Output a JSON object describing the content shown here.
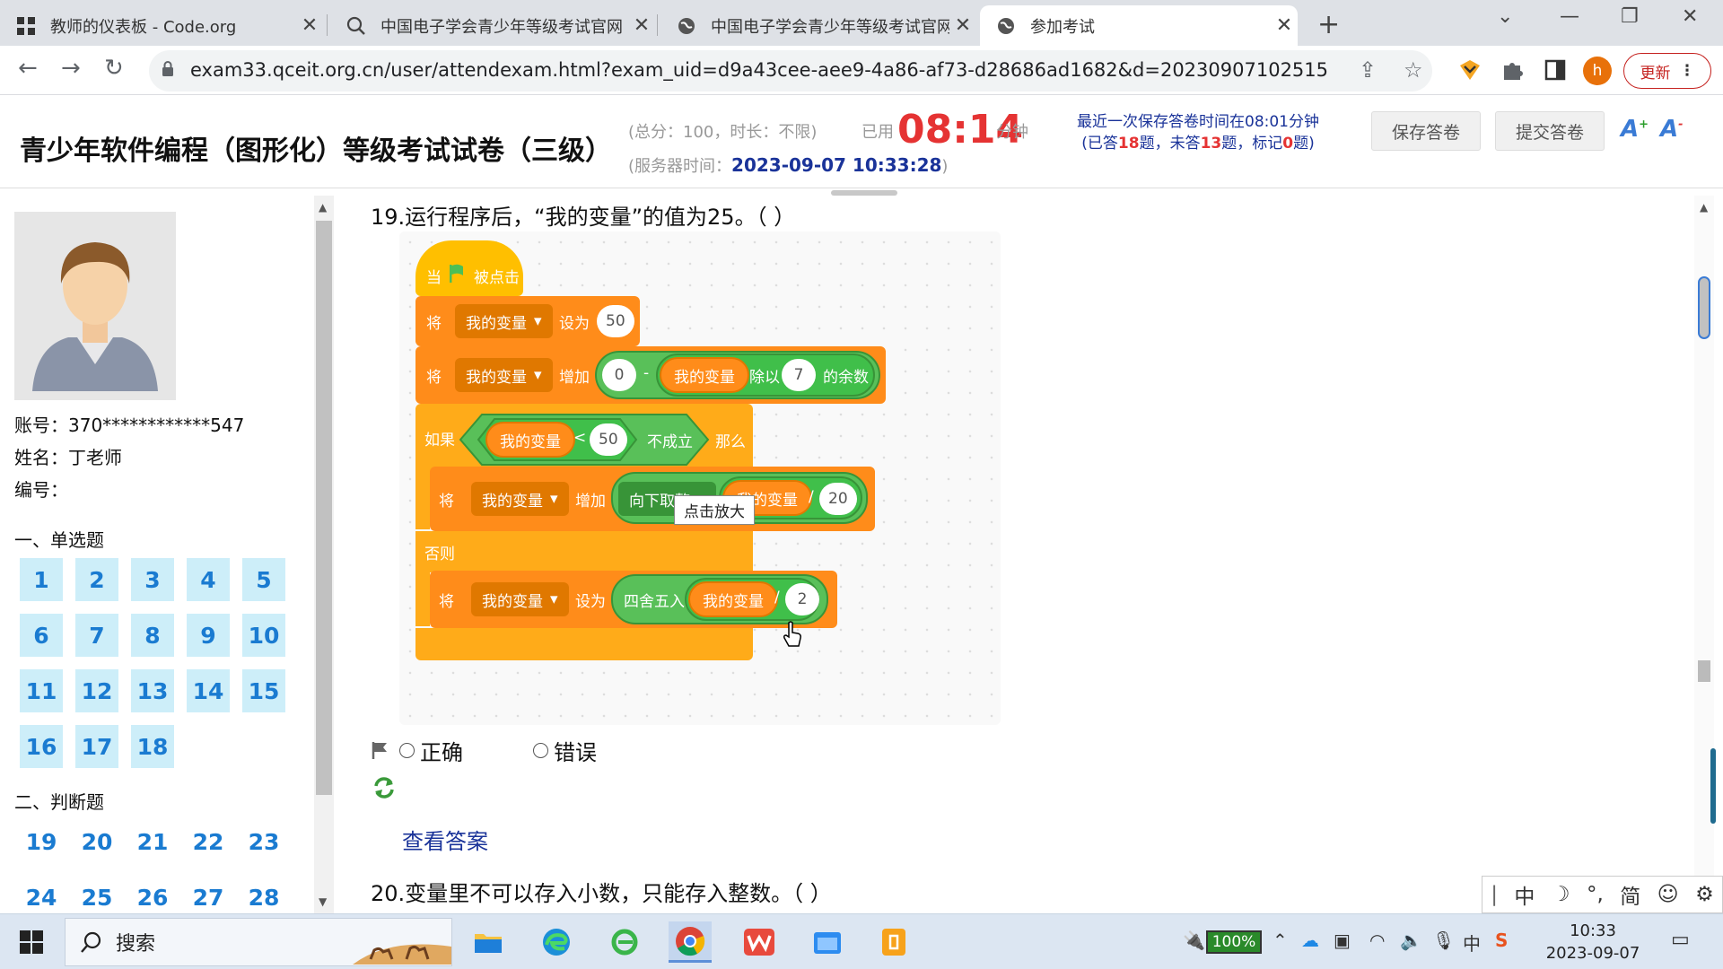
{
  "browser": {
    "tabs": [
      {
        "title": "教师的仪表板 - Code.org",
        "icon": "grid-icon"
      },
      {
        "title": "中国电子学会青少年等级考试官网",
        "icon": "search-icon"
      },
      {
        "title": "中国电子学会青少年等级考试官网",
        "icon": "globe-icon"
      },
      {
        "title": "参加考试",
        "icon": "globe-icon"
      }
    ],
    "url": "exam33.qceit.org.cn/user/attendexam.html?exam_uid=d9a43cee-aee9-4a86-af73-d28686ad1682&d=20230907102515",
    "profile_initial": "h",
    "update_label": "更新"
  },
  "exam": {
    "title": "青少年软件编程（图形化）等级考试试卷（三级）",
    "score_info": "(总分：100，时长：不限)",
    "used_label": "已用",
    "elapsed": "08:14",
    "minutes_unit": "分钟",
    "server_time_label": "(服务器时间：",
    "server_time": "2023-09-07 10:33:28",
    "server_time_close": ")",
    "last_save": "最近一次保存答卷时间在08:01分钟",
    "answered_prefix": "(已答",
    "answered": "18",
    "unanswered_prefix": "题，未答",
    "unanswered": "13",
    "marked_prefix": "题，标记",
    "marked": "0",
    "marked_suffix": "题)",
    "save_button": "保存答卷",
    "submit_button": "提交答卷"
  },
  "user": {
    "account": "账号：370************547",
    "name": "姓名：丁老师",
    "number": "编号："
  },
  "sections": [
    {
      "title": "一、单选题",
      "questions": [
        "1",
        "2",
        "3",
        "4",
        "5",
        "6",
        "7",
        "8",
        "9",
        "10",
        "11",
        "12",
        "13",
        "14",
        "15",
        "16",
        "17",
        "18"
      ]
    },
    {
      "title": "二、判断题",
      "questions": [
        "19",
        "20",
        "21",
        "22",
        "23",
        "24",
        "25",
        "26",
        "27",
        "28"
      ]
    }
  ],
  "question": {
    "title": "19.运行程序后，“我的变量”的值为25。（ ）",
    "zoom_tip": "点击放大",
    "options": [
      "正确",
      "错误"
    ],
    "view_answer": "查看答案",
    "next_title": "20.变量里不可以存入小数，只能存入整数。（ ）"
  },
  "scratch": {
    "when": "当",
    "clicked": "被点击",
    "set_word": "将",
    "var_name": "我的变量",
    "set_to": "设为",
    "val_50": "50",
    "increase": "增加",
    "val_0": "0",
    "minus": "-",
    "mod_word": "除以",
    "val_7": "7",
    "mod_suffix": "的余数",
    "if_word": "如果",
    "lt": "<",
    "not_hold": "不成立",
    "then_word": "那么",
    "floor_word": "向下取整",
    "div": "/",
    "val_20": "20",
    "else_word": "否则",
    "round_word": "四舍五入",
    "val_2": "2"
  },
  "ime": [
    "中",
    "简"
  ],
  "taskbar": {
    "search": "搜索",
    "battery": "100%",
    "ime_tray": "中",
    "time": "10:33",
    "date": "2023-09-07"
  }
}
